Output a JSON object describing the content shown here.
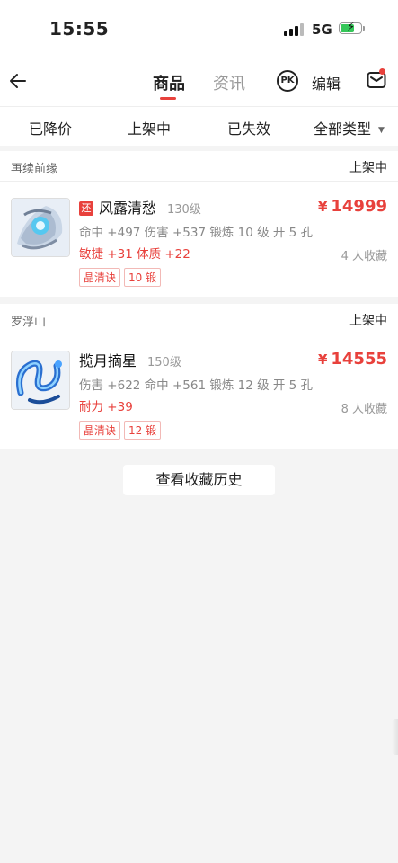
{
  "status_bar": {
    "time": "15:55",
    "network": "5G"
  },
  "nav": {
    "tabs": [
      {
        "label": "商品"
      },
      {
        "label": "资讯"
      }
    ],
    "pk_label": "PK",
    "edit_label": "编辑"
  },
  "filters": [
    {
      "label": "已降价"
    },
    {
      "label": "上架中"
    },
    {
      "label": "已失效"
    },
    {
      "label": "全部类型"
    }
  ],
  "items": [
    {
      "server": "再续前缘",
      "status": "上架中",
      "badge": "还",
      "name": "风露清愁",
      "level": "130级",
      "price_symbol": "¥",
      "price": "14999",
      "attr_line1": "命中 +497 伤害 +537 锻炼 10 级 开 5 孔",
      "attr_line2": "敏捷 +31 体质 +22",
      "favorites": "4 人收藏",
      "tags": [
        "晶清诀",
        "10 锻"
      ]
    },
    {
      "server": "罗浮山",
      "status": "上架中",
      "name": "揽月摘星",
      "level": "150级",
      "price_symbol": "¥",
      "price": "14555",
      "attr_line1": "伤害 +622 命中 +561 锻炼 12 级 开 5 孔",
      "attr_line2": "耐力 +39",
      "favorites": "8 人收藏",
      "tags": [
        "晶清诀",
        "12 锻"
      ]
    }
  ],
  "history_button": "查看收藏历史",
  "colors": {
    "accent": "#e8413c",
    "battery": "#35c759"
  }
}
